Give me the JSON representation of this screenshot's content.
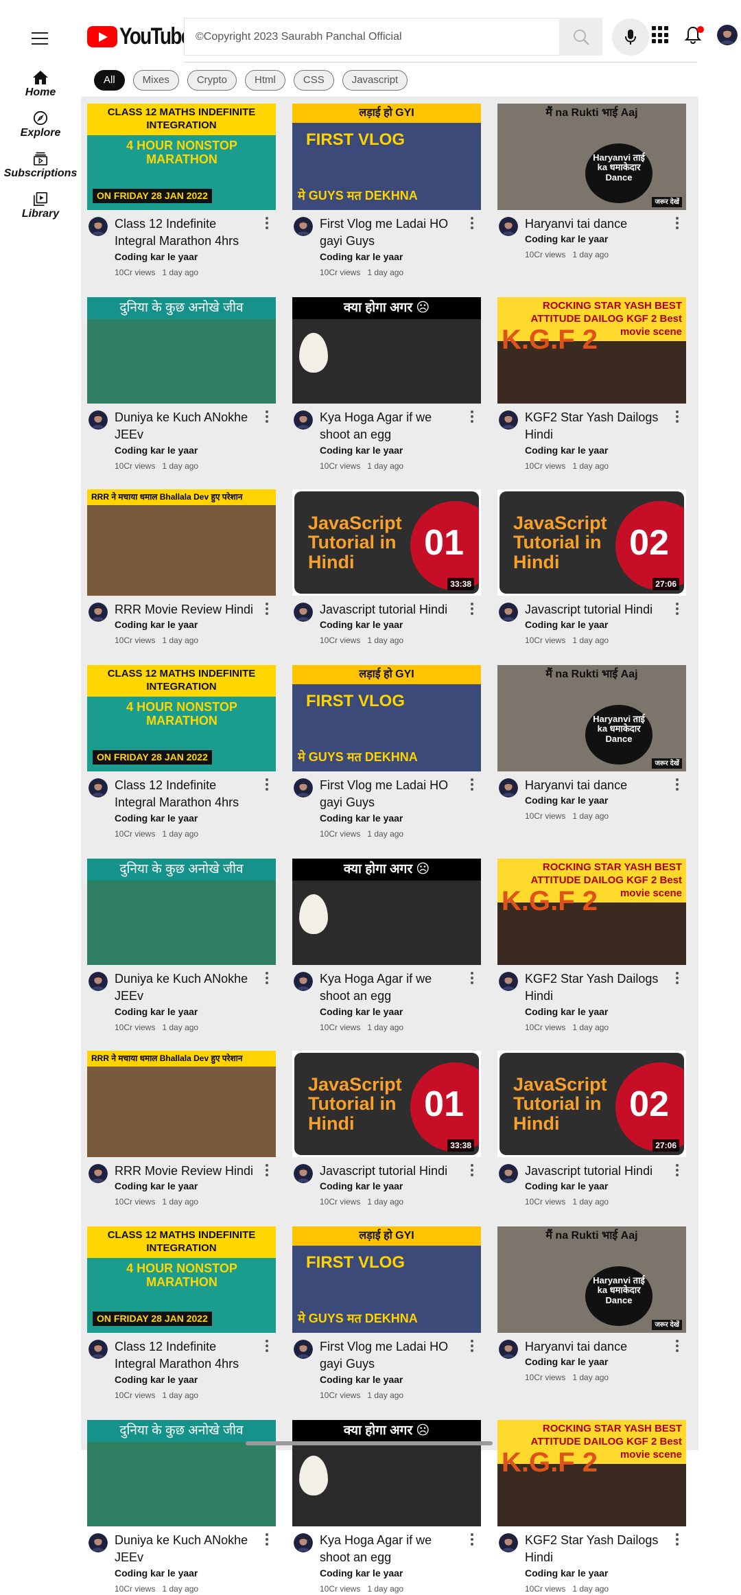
{
  "sidebar": {
    "items": [
      {
        "label": "Home"
      },
      {
        "label": "Explore"
      },
      {
        "label": "Subscriptions"
      },
      {
        "label": "Library"
      }
    ]
  },
  "header": {
    "logo_text": "YouTube",
    "search_placeholder": "©Copyright 2023 Saurabh Panchal Official",
    "notification_dot_color": "#ff0000"
  },
  "chips": [
    "All",
    "Mixes",
    "Crypto",
    "Html",
    "CSS",
    "Javascript"
  ],
  "videos": [
    {
      "title": "Class 12 Indefinite Integral Marathon 4hrs",
      "channel": "Coding kar le yaar",
      "views": "10Cr views",
      "age": "1 day ago",
      "thumb": {
        "theme": "maths",
        "top": "CLASS 12 MATHS INDEFINITE INTEGRATION",
        "mid": "4 HOUR NONSTOP MARATHON",
        "bottom": "ON FRIDAY 28 JAN 2022"
      }
    },
    {
      "title": "First Vlog me Ladai HO gayi Guys",
      "channel": "Coding kar le yaar",
      "views": "10Cr views",
      "age": "1 day ago",
      "thumb": {
        "theme": "vlog",
        "top": "लड़ाई हो GYI",
        "mid": "FIRST VLOG",
        "bottom": "मे GUYS मत DEKHNA"
      }
    },
    {
      "title": "Haryanvi tai dance",
      "channel": "Coding kar le yaar",
      "views": "10Cr views",
      "age": "1 day ago",
      "thumb": {
        "theme": "dance",
        "top": "मैं na Rukti भाई Aaj",
        "mid": "Haryanvi ताई ka धमाकेदार Dance",
        "bottom": "जरूर देखें"
      }
    },
    {
      "title": "Duniya ke Kuch ANokhe JEEv",
      "channel": "Coding kar le yaar",
      "views": "10Cr views",
      "age": "1 day ago",
      "thumb": {
        "theme": "jeev",
        "top": "दुनिया के कुछ अनोखे जीव"
      }
    },
    {
      "title": "Kya Hoga Agar if we shoot an egg",
      "channel": "Coding kar le yaar",
      "views": "10Cr views",
      "age": "1 day ago",
      "thumb": {
        "theme": "egg",
        "top": "क्या होगा अगर ☹"
      }
    },
    {
      "title": "KGF2 Star Yash Dailogs Hindi",
      "channel": "Coding kar le yaar",
      "views": "10Cr views",
      "age": "1 day ago",
      "thumb": {
        "theme": "kgf",
        "top": "ROCKING STAR YASH BEST ATTITUDE DAILOG KGF 2 Best movie scene",
        "mid": "K.G.F 2"
      }
    },
    {
      "title": "RRR Movie Review Hindi",
      "channel": "Coding kar le yaar",
      "views": "10Cr views",
      "age": "1 day ago",
      "thumb": {
        "theme": "rrr",
        "top": "RRR ने मचाया धमाल   Bhallala Dev हुए परेशान"
      }
    },
    {
      "title": "Javascript tutorial Hindi",
      "channel": "Coding kar le yaar",
      "views": "10Cr views",
      "age": "1 day ago",
      "thumb": {
        "theme": "js",
        "top": "JavaScript Tutorial in Hindi",
        "mid": "01",
        "duration": "33:38"
      }
    },
    {
      "title": "Javascript tutorial Hindi",
      "channel": "Coding kar le yaar",
      "views": "10Cr views",
      "age": "1 day ago",
      "thumb": {
        "theme": "js",
        "top": "JavaScript Tutorial in Hindi",
        "mid": "02",
        "duration": "27:06"
      }
    }
  ]
}
